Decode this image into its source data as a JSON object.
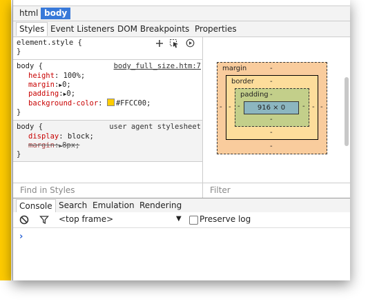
{
  "breadcrumbs": [
    "html",
    "body"
  ],
  "sidebar_tabs": [
    "Styles",
    "Event Listeners",
    "DOM Breakpoints",
    "Properties"
  ],
  "rules": {
    "element_style": {
      "selector": "element.style {",
      "close": "}"
    },
    "body1": {
      "selector": "body {",
      "source": "body_full_size.htm:7",
      "props": [
        {
          "name": "height",
          "value": "100%;"
        },
        {
          "name": "margin",
          "value": "0;"
        },
        {
          "name": "padding",
          "value": "0;"
        },
        {
          "name": "background-color",
          "value": "#FFCC00;"
        }
      ],
      "close": "}"
    },
    "body2": {
      "selector": "body {",
      "source": "user agent stylesheet",
      "props": [
        {
          "name": "display",
          "value": "block;"
        },
        {
          "name": "margin",
          "value": "8px;"
        }
      ],
      "close": "}"
    }
  },
  "box_model": {
    "margin_label": "margin",
    "border_label": "border",
    "padding_label": "padding",
    "dash": "-",
    "content_size": "916 × 0"
  },
  "find_placeholder": "Find in Styles",
  "filter_placeholder": "Filter",
  "drawer_tabs": [
    "Console",
    "Search",
    "Emulation",
    "Rendering"
  ],
  "console": {
    "frame_select": "<top frame>",
    "preserve_log": "Preserve log",
    "prompt": "›"
  },
  "colors": {
    "accent": "#3879d9",
    "page_bg": "#FFCC00",
    "css_prop": "#c80000"
  }
}
